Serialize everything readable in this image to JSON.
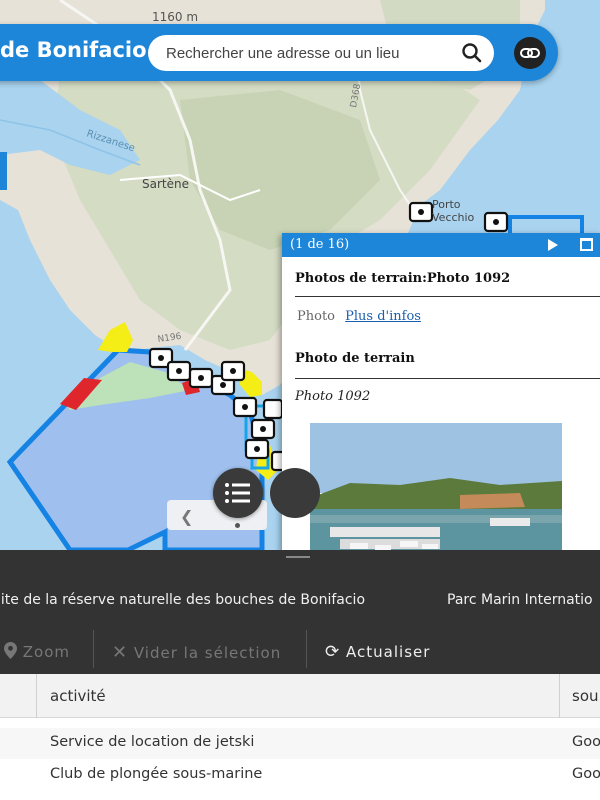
{
  "app": {
    "title": "de Bonifacio"
  },
  "search": {
    "placeholder": "Rechercher une adresse ou un lieu"
  },
  "icons": {
    "search": "search-icon",
    "share_link": "link-icon",
    "list": "list-icon",
    "next": "play-next-icon",
    "maximize": "maximize-icon",
    "zoom": "location-pin-icon",
    "clear": "close-x-icon",
    "refresh": "refresh-icon"
  },
  "map": {
    "labels": {
      "elevation": "1160 m",
      "sartene": "Sartène",
      "porto": "Porto",
      "vecchio": "Vecchio",
      "river": "Rizzanese",
      "road_n196": "N196",
      "road_d368": "D368"
    }
  },
  "popup": {
    "counter": "(1 de 16)",
    "title": "Photos de terrain:Photo 1092",
    "photo_label": "Photo",
    "more_info_link": "Plus d'infos",
    "section_title": "Photo de terrain",
    "photo_name": "Photo 1092"
  },
  "panel": {
    "tabs": [
      "nite de la réserve naturelle des bouches de Bonifacio",
      "Parc Marin Internatio"
    ],
    "toolbar": {
      "zoom": "Zoom",
      "clear_selection": "Vider la sélection",
      "refresh": "Actualiser"
    },
    "table": {
      "columns": [
        "activité",
        "sou"
      ],
      "rows": [
        {
          "activite": "Service de location de jetski",
          "source": "Goo"
        },
        {
          "activite": "Club de plongée sous-marine",
          "source": "Goo"
        }
      ]
    }
  },
  "colors": {
    "accent": "#1e86d8",
    "panel_bg": "#333333",
    "sea": "#a9d3ef",
    "reserve_fill": "#9fc0ee",
    "reserve_outline": "#1583e4",
    "highlight_yellow": "#f4ee16",
    "zone_red": "#e0262d",
    "zone_green": "#bfe3b4"
  }
}
